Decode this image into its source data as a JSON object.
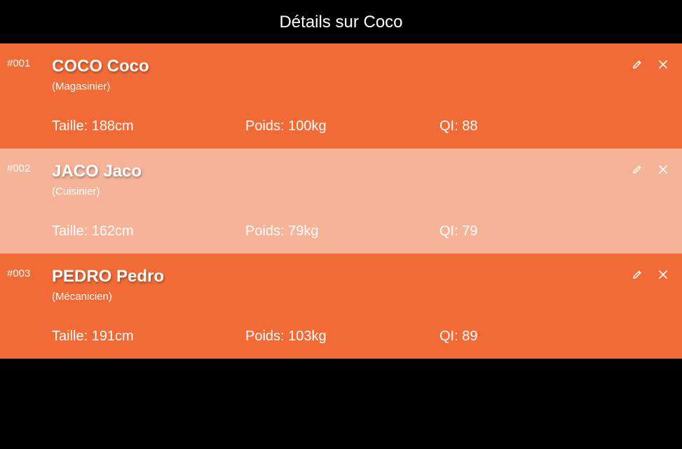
{
  "header": {
    "title": "Détails sur Coco"
  },
  "colors": {
    "row_primary": "#f26b36",
    "row_secondary": "#f7b398",
    "background": "#000000",
    "text": "#ffffff"
  },
  "icons": {
    "edit": "pencil-icon",
    "delete": "close-icon"
  },
  "people": [
    {
      "id": "#001",
      "name": "COCO Coco",
      "role": "(Magasinier)",
      "height": "Taille: 188cm",
      "weight": "Poids: 100kg",
      "iq": "QI: 88"
    },
    {
      "id": "#002",
      "name": "JACO Jaco",
      "role": "(Cuisinier)",
      "height": "Taille: 162cm",
      "weight": "Poids: 79kg",
      "iq": "QI: 79"
    },
    {
      "id": "#003",
      "name": "PEDRO Pedro",
      "role": "(Mécanicien)",
      "height": "Taille: 191cm",
      "weight": "Poids: 103kg",
      "iq": "QI: 89"
    }
  ]
}
